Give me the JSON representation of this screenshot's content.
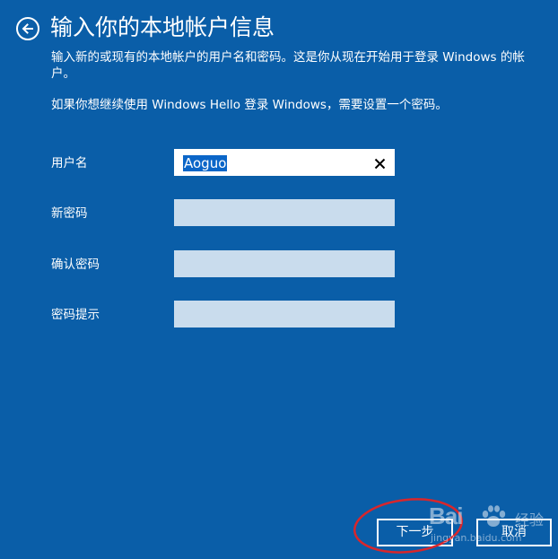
{
  "header": {
    "title": "输入你的本地帐户信息",
    "back_icon": "back-arrow-icon"
  },
  "description": {
    "line1": "输入新的或现有的本地帐户的用户名和密码。这是你从现在开始用于登录 Windows 的帐户。",
    "line2": "如果你想继续使用 Windows Hello 登录 Windows，需要设置一个密码。"
  },
  "form": {
    "username_label": "用户名",
    "username_value": "Aoguo",
    "new_password_label": "新密码",
    "new_password_value": "",
    "confirm_password_label": "确认密码",
    "confirm_password_value": "",
    "password_hint_label": "密码提示",
    "password_hint_value": ""
  },
  "buttons": {
    "next_label": "下一步",
    "cancel_label": "取消"
  },
  "watermark": {
    "logo": "Bai  ",
    "logo_suffix": "经验",
    "url": "jingyan.baidu.com"
  },
  "colors": {
    "background": "#0a5ea8",
    "field_inactive": "#c9dced",
    "selection": "#0b66c8",
    "annotation": "#d9262b"
  }
}
